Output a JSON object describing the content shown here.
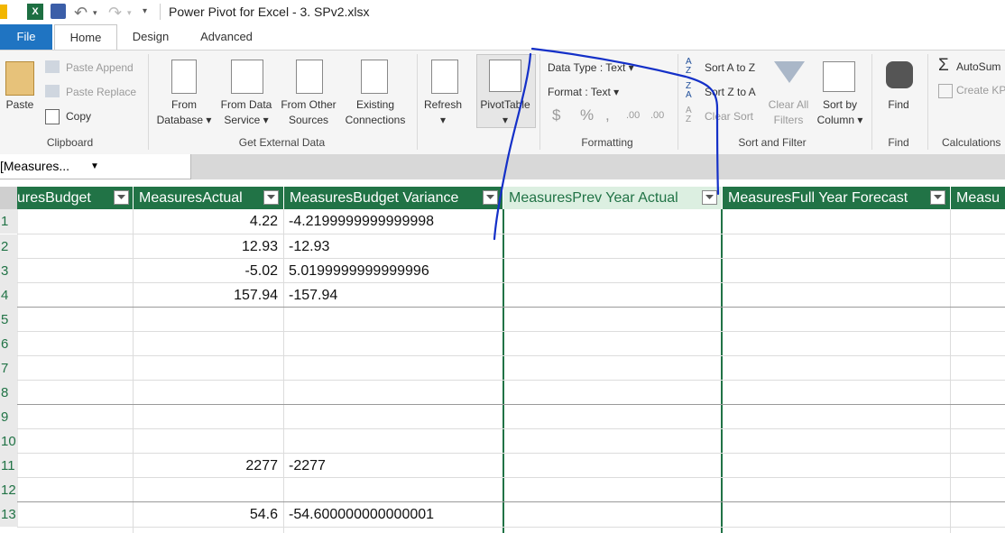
{
  "window": {
    "title": "Power Pivot for Excel - 3. SPv2.xlsx"
  },
  "tabs": [
    {
      "label": "File"
    },
    {
      "label": "Home"
    },
    {
      "label": "Design"
    },
    {
      "label": "Advanced"
    }
  ],
  "ribbon": {
    "clipboard": {
      "paste": "Paste",
      "paste_append": "Paste Append",
      "paste_replace": "Paste Replace",
      "copy": "Copy",
      "group": "Clipboard"
    },
    "external": {
      "from_database_1": "From",
      "from_database_2": "Database",
      "from_data_service_1": "From Data",
      "from_data_service_2": "Service",
      "from_other_1": "From Other",
      "from_other_2": "Sources",
      "existing_1": "Existing",
      "existing_2": "Connections",
      "group": "Get External Data"
    },
    "refresh": "Refresh",
    "pivottable": "PivotTable",
    "formatting": {
      "data_type": "Data Type : Text",
      "format": "Format : Text",
      "group": "Formatting"
    },
    "sort": {
      "sort_az": "Sort A to Z",
      "sort_za": "Sort Z to A",
      "clear_sort": "Clear Sort",
      "clear_all_1": "Clear All",
      "clear_all_2": "Filters",
      "sort_by_1": "Sort by",
      "sort_by_2": "Column",
      "group": "Sort and Filter"
    },
    "find": {
      "label": "Find",
      "group": "Find"
    },
    "calc": {
      "autosum": "AutoSum",
      "create_kpi": "Create KP",
      "group": "Calculations"
    }
  },
  "name_box": {
    "value": "[Measures..."
  },
  "columns": [
    {
      "label": "uresBudget"
    },
    {
      "label": "MeasuresActual"
    },
    {
      "label": "MeasuresBudget Variance"
    },
    {
      "label": "MeasuresPrev Year Actual"
    },
    {
      "label": "MeasuresFull Year Forecast"
    },
    {
      "label": "Measu"
    }
  ],
  "rows": [
    {
      "n": "1",
      "actual": "4.22",
      "variance": "-4.2199999999999998"
    },
    {
      "n": "2",
      "actual": "12.93",
      "variance": "-12.93"
    },
    {
      "n": "3",
      "actual": "-5.02",
      "variance": "5.0199999999999996"
    },
    {
      "n": "4",
      "actual": "157.94",
      "variance": "-157.94"
    },
    {
      "n": "5",
      "actual": "",
      "variance": ""
    },
    {
      "n": "6",
      "actual": "",
      "variance": ""
    },
    {
      "n": "7",
      "actual": "",
      "variance": ""
    },
    {
      "n": "8",
      "actual": "",
      "variance": ""
    },
    {
      "n": "9",
      "actual": "",
      "variance": ""
    },
    {
      "n": "10",
      "actual": "",
      "variance": ""
    },
    {
      "n": "11",
      "actual": "2277",
      "variance": "-2277"
    },
    {
      "n": "12",
      "actual": "",
      "variance": ""
    },
    {
      "n": "13",
      "actual": "54.6",
      "variance": "-54.600000000000001"
    }
  ],
  "colors": {
    "excel_green": "#217346",
    "file_blue": "#1f74c2",
    "annotation": "#1430c8"
  }
}
